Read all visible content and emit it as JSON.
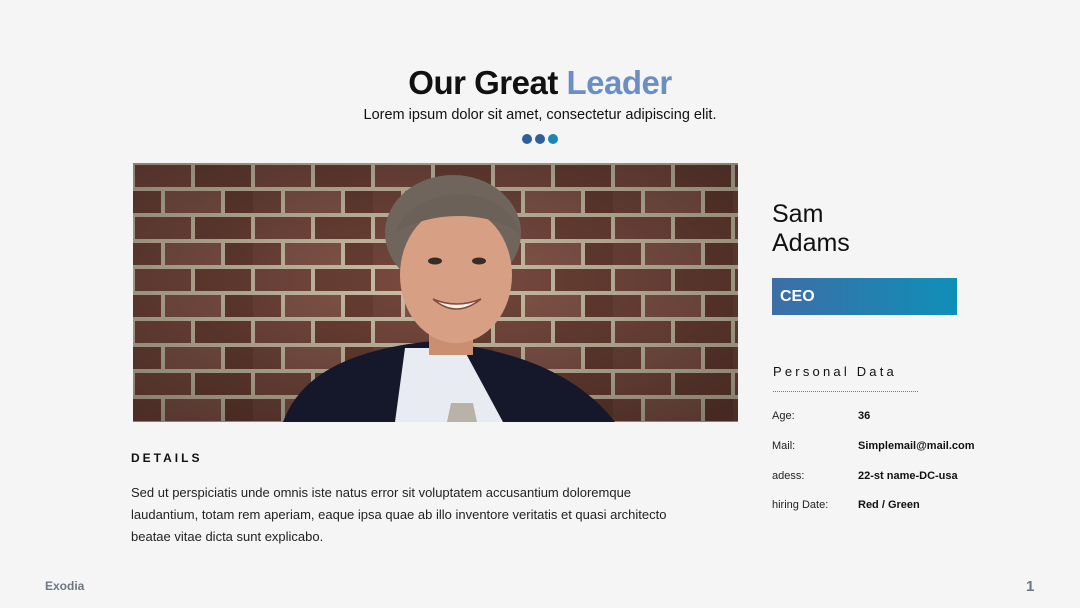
{
  "header": {
    "title_main": "Our Great",
    "title_accent": "Leader",
    "subtitle": "Lorem ipsum dolor sit amet, consectetur adipiscing elit.",
    "dot_colors": [
      "#2f5f98",
      "#2f5f98",
      "#1a86b4"
    ]
  },
  "details": {
    "heading": "DETAILS",
    "body": "Sed ut perspiciatis unde omnis iste natus error sit voluptatem accusantium doloremque laudantium, totam rem aperiam, eaque ipsa quae ab illo inventore veritatis et quasi architecto beatae vitae dicta sunt explicabo."
  },
  "profile": {
    "first_name": "Sam",
    "last_name": "Adams",
    "role": "CEO",
    "personal_data_heading": "Personal Data",
    "rows": [
      {
        "label": "Age:",
        "value": "36"
      },
      {
        "label": "Mail:",
        "value": "Simplemail@mail.com"
      },
      {
        "label": "adess:",
        "value": "22-st name-DC-usa"
      },
      {
        "label": "hiring Date:",
        "value": "Red / Green"
      }
    ]
  },
  "footer": {
    "logo": "Exodia",
    "page_number": "1"
  },
  "colors": {
    "accent": "#6b8fc4",
    "role_gradient_start": "#3d6ea6",
    "role_gradient_end": "#0f8fb8"
  }
}
